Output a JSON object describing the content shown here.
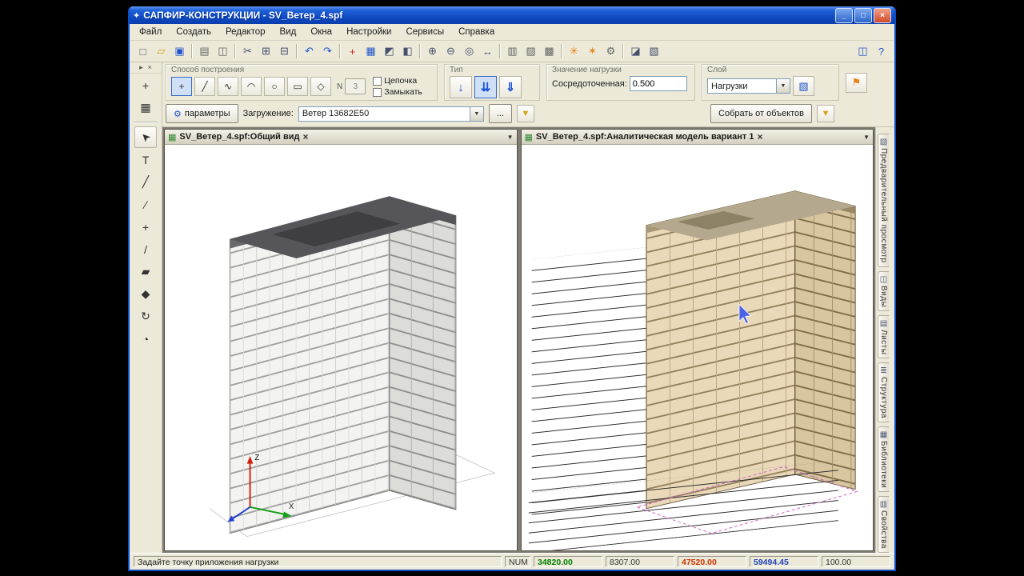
{
  "window": {
    "title": "САПФИР-КОНСТРУКЦИИ - SV_Ветер_4.spf",
    "app_icon_glyph": "✦",
    "minimize_glyph": "_",
    "maximize_glyph": "□",
    "close_glyph": "×"
  },
  "menu": {
    "items": [
      "Файл",
      "Создать",
      "Редактор",
      "Вид",
      "Окна",
      "Настройки",
      "Сервисы",
      "Справка"
    ]
  },
  "toolbar": {
    "icons": [
      {
        "name": "new-file-icon",
        "glyph": "□"
      },
      {
        "name": "open-folder-icon",
        "glyph": "▱"
      },
      {
        "name": "save-icon",
        "glyph": "▣"
      },
      {
        "name": "print-icon",
        "glyph": "▤"
      },
      {
        "name": "print-preview-icon",
        "glyph": "◫"
      },
      {
        "name": "cut-icon",
        "glyph": "✂"
      },
      {
        "name": "copy-icon",
        "glyph": "⊞"
      },
      {
        "name": "paste-icon",
        "glyph": "⊟"
      },
      {
        "name": "undo-icon",
        "glyph": "↶"
      },
      {
        "name": "redo-icon",
        "glyph": "↷"
      },
      {
        "name": "crosshair-icon",
        "glyph": "+"
      },
      {
        "name": "grid-icon",
        "glyph": "▦"
      },
      {
        "name": "snap-icon",
        "glyph": "◩"
      },
      {
        "name": "layers-icon",
        "glyph": "◧"
      },
      {
        "name": "zoom-in-icon",
        "glyph": "⊕"
      },
      {
        "name": "zoom-out-icon",
        "glyph": "⊖"
      },
      {
        "name": "zoom-fit-icon",
        "glyph": "◎"
      },
      {
        "name": "pan-icon",
        "glyph": "↔"
      },
      {
        "name": "view-top-icon",
        "glyph": "▥"
      },
      {
        "name": "view-front-icon",
        "glyph": "▨"
      },
      {
        "name": "view-iso-icon",
        "glyph": "▩"
      },
      {
        "name": "sun-icon",
        "glyph": "✳"
      },
      {
        "name": "render-icon",
        "glyph": "✶"
      },
      {
        "name": "settings-gear-icon",
        "glyph": "⚙"
      },
      {
        "name": "section-icon",
        "glyph": "◪"
      },
      {
        "name": "wireframe-icon",
        "glyph": "▧"
      },
      {
        "name": "arrange-windows-icon",
        "glyph": "◫"
      },
      {
        "name": "help-icon",
        "glyph": "?"
      }
    ]
  },
  "dock": {
    "pin_glyph": "▸",
    "close_glyph": "×",
    "top_icons": [
      {
        "name": "ucs-tool-icon",
        "glyph": "+"
      },
      {
        "name": "grid-table-icon",
        "glyph": "▦"
      }
    ],
    "tools": [
      {
        "name": "pointer-tool-icon",
        "glyph": "➤"
      },
      {
        "name": "text-tool-icon",
        "glyph": "T"
      },
      {
        "name": "node-edit-tool-icon",
        "glyph": "╱"
      },
      {
        "name": "line-tool-icon",
        "glyph": "∕"
      },
      {
        "name": "cross-tool-icon",
        "glyph": "+"
      },
      {
        "name": "slope-tool-icon",
        "glyph": "/"
      },
      {
        "name": "eraser-tool-icon",
        "glyph": "▰"
      },
      {
        "name": "fill-tool-icon",
        "glyph": "◆"
      },
      {
        "name": "rotate-tool-icon",
        "glyph": "↻"
      },
      {
        "name": "orbit-tool-icon",
        "glyph": "◔"
      }
    ]
  },
  "ribbon": {
    "method": {
      "title": "Способ построения",
      "tools": [
        {
          "name": "point-tool",
          "glyph": "+"
        },
        {
          "name": "line-tool",
          "glyph": "╱"
        },
        {
          "name": "polyline-tool",
          "glyph": "∿"
        },
        {
          "name": "arc-tool",
          "glyph": "◠"
        },
        {
          "name": "ellipse-tool",
          "glyph": "○"
        },
        {
          "name": "rectangle-tool",
          "glyph": "▭"
        },
        {
          "name": "polygon-tool",
          "glyph": "◇"
        }
      ],
      "n_label": "N",
      "n_value": "3",
      "chain_label": "Цепочка",
      "close_label": "Замыкать"
    },
    "type": {
      "title": "Тип",
      "buttons": [
        {
          "name": "concentrated-load-button",
          "glyph": "↓"
        },
        {
          "name": "distributed-load-button",
          "glyph": "⇊"
        },
        {
          "name": "trapezoid-load-button",
          "glyph": "⇓"
        }
      ]
    },
    "value": {
      "title": "Значение нагрузки",
      "label": "Сосредоточенная:",
      "value": "0.500"
    },
    "layer": {
      "title": "Слой",
      "selected": "Нагрузки",
      "dd_glyph": "▼",
      "layers_icon_glyph": "▧"
    },
    "axis_icon_glyph": "⚑",
    "row2": {
      "params_icon_glyph": "⚙",
      "params_label": "параметры",
      "loading_label": "Загружение:",
      "loading_value": "Ветер 13682E50",
      "dd_glyph": "▼",
      "more_label": "...",
      "filter_glyph": "▼",
      "collect_label": "Собрать от объектов",
      "filter2_glyph": "▼"
    }
  },
  "docs": {
    "left": {
      "title": "SV_Ветер_4.spf:Общий вид",
      "icon_glyph": "▦",
      "close_glyph": "×",
      "dd_glyph": "▼"
    },
    "right": {
      "title": "SV_Ветер_4.spf:Аналитическая модель вариант 1",
      "icon_glyph": "▦",
      "close_glyph": "×",
      "dd_glyph": "▼"
    },
    "axes": {
      "z": "Z",
      "x": "X"
    }
  },
  "right_tabs": {
    "items": [
      {
        "name": "tab-preview",
        "label": "Предварительный просмотр",
        "icon": "▧"
      },
      {
        "name": "tab-views",
        "label": "Виды",
        "icon": "◫"
      },
      {
        "name": "tab-sheets",
        "label": "Листы",
        "icon": "▤"
      },
      {
        "name": "tab-structure",
        "label": "Структура",
        "icon": "≣"
      },
      {
        "name": "tab-libraries",
        "label": "Библиотеки",
        "icon": "▦"
      },
      {
        "name": "tab-properties",
        "label": "Свойства",
        "icon": "▥"
      }
    ]
  },
  "statusbar": {
    "message": "Задайте точку приложения нагрузки",
    "num_label": "NUM",
    "values": [
      {
        "text": "34820.00",
        "color": "#008000"
      },
      {
        "text": "8307.00",
        "color": "#333333"
      },
      {
        "text": "47520.00",
        "color": "#cc3300"
      },
      {
        "text": "59494.45",
        "color": "#2244bb"
      },
      {
        "text": "100.00",
        "color": "#333333"
      }
    ]
  }
}
